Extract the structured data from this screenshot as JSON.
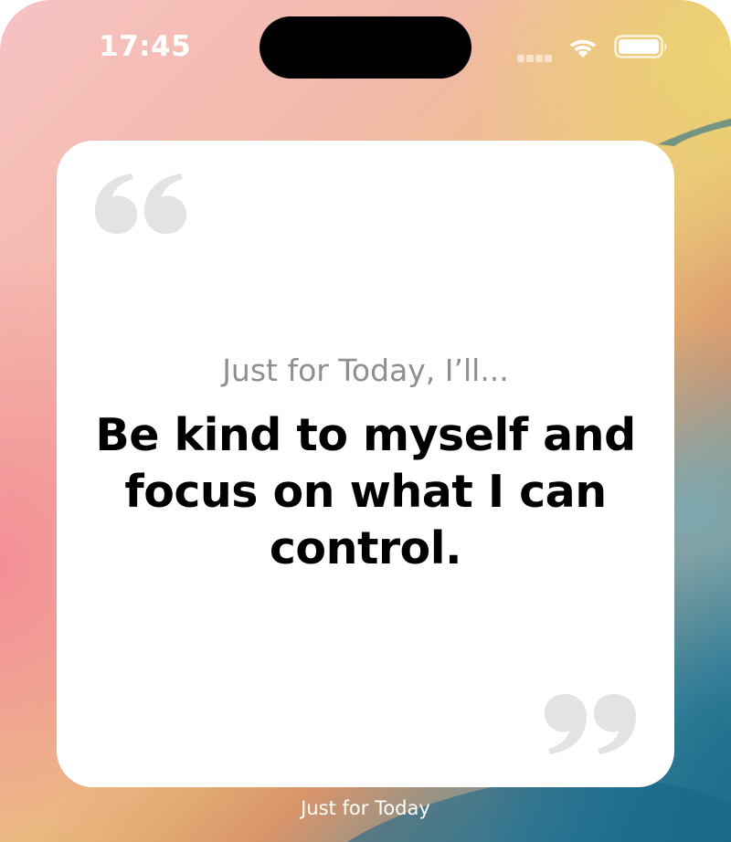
{
  "status_bar": {
    "time": "17:45",
    "icons": [
      "cellular-signal-icon",
      "wifi-icon",
      "battery-icon"
    ]
  },
  "widget": {
    "intro": "Just for Today, I’ll...",
    "quote": "Be kind to myself and focus on what I can control.",
    "label": "Just for Today",
    "open_quote_icon": "open-quote-icon",
    "close_quote_icon": "close-quote-icon"
  },
  "colors": {
    "card_background": "#ffffff",
    "intro_text": "#8e8e93",
    "quote_text": "#000000",
    "quote_marks": "#e3e3e3",
    "label_text": "#ffffff"
  }
}
